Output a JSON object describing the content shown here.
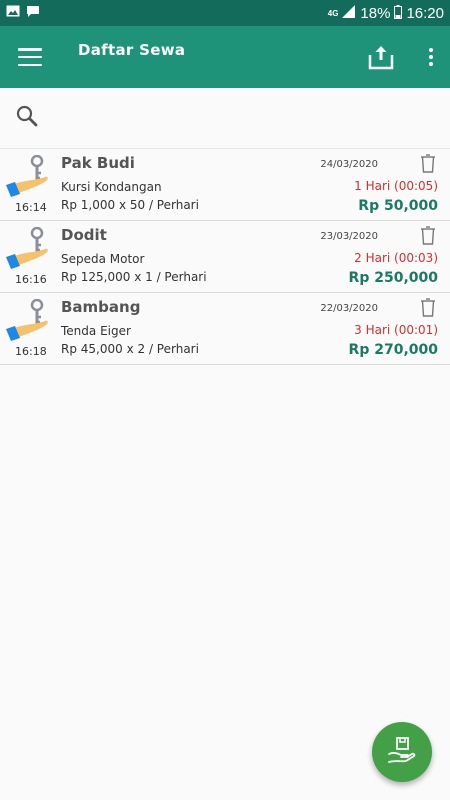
{
  "status_bar": {
    "network": "4G",
    "battery": "18%",
    "time": "16:20"
  },
  "app_bar": {
    "title": "Daftar Sewa"
  },
  "rentals": [
    {
      "name": "Pak Budi",
      "item": "Kursi Kondangan",
      "price": "Rp 1,000 x 50 /  Perhari",
      "date": "24/03/2020",
      "duration": "1 Hari (00:05)",
      "total": "Rp 50,000",
      "time": "16:14"
    },
    {
      "name": "Dodit",
      "item": "Sepeda Motor",
      "price": "Rp 125,000 x 1 /  Perhari",
      "date": "23/03/2020",
      "duration": "2 Hari (00:03)",
      "total": "Rp 250,000",
      "time": "16:16"
    },
    {
      "name": "Bambang",
      "item": "Tenda Eiger",
      "price": "Rp 45,000 x 2 /  Perhari",
      "date": "22/03/2020",
      "duration": "3 Hari (00:01)",
      "total": "Rp 270,000",
      "time": "16:18"
    }
  ],
  "colors": {
    "status_bar": "#136b5b",
    "app_bar": "#1f927a",
    "fab": "#43a047",
    "duration_text": "#d32f2f",
    "total_text": "#1a7a63"
  }
}
